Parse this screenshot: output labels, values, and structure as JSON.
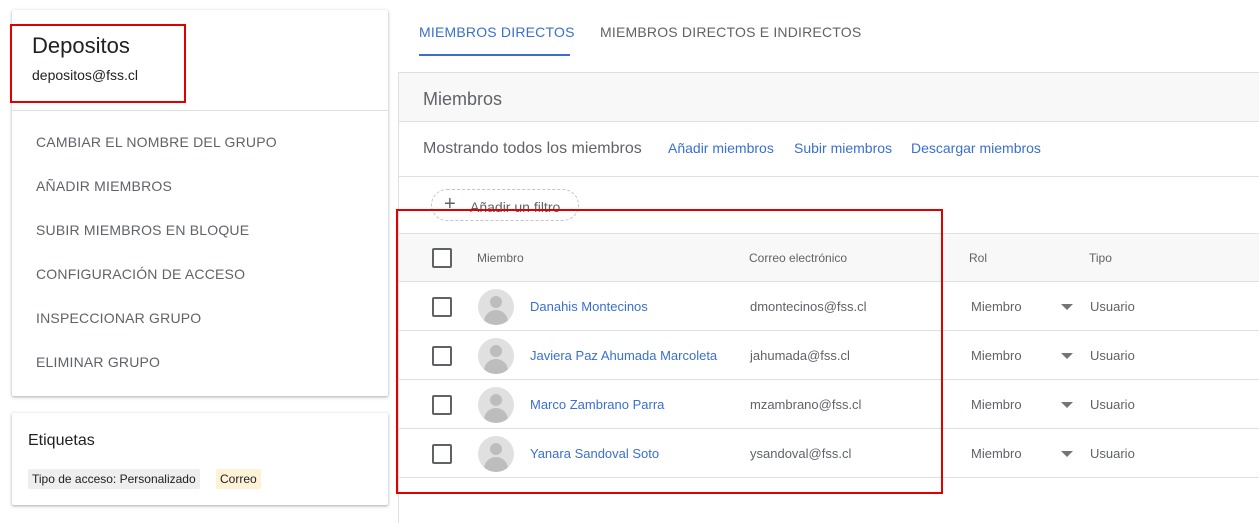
{
  "group": {
    "name": "Depositos",
    "email": "depositos@fss.cl",
    "actions": [
      {
        "label": "CAMBIAR EL NOMBRE DEL GRUPO"
      },
      {
        "label": "AÑADIR MIEMBROS"
      },
      {
        "label": "SUBIR MIEMBROS EN BLOQUE"
      },
      {
        "label": "CONFIGURACIÓN DE ACCESO"
      },
      {
        "label": "INSPECCIONAR GRUPO"
      },
      {
        "label": "ELIMINAR GRUPO"
      }
    ]
  },
  "tags": {
    "title": "Etiquetas",
    "chips": [
      "Tipo de acceso: Personalizado",
      "Correo"
    ]
  },
  "tabs": [
    {
      "label": "MIEMBROS DIRECTOS",
      "active": true
    },
    {
      "label": "MIEMBROS DIRECTOS E INDIRECTOS",
      "active": false
    }
  ],
  "members_panel": {
    "title": "Miembros",
    "showing": "Mostrando todos los miembros",
    "links": {
      "add": "Añadir miembros",
      "upload": "Subir miembros",
      "download": "Descargar miembros"
    },
    "filter_label": "Añadir un filtro",
    "columns": {
      "member": "Miembro",
      "email": "Correo electrónico",
      "role": "Rol",
      "type": "Tipo"
    },
    "rows": [
      {
        "name": "Danahis Montecinos",
        "email": "dmontecinos@fss.cl",
        "role": "Miembro",
        "type": "Usuario"
      },
      {
        "name": "Javiera Paz Ahumada Marcoleta",
        "email": "jahumada@fss.cl",
        "role": "Miembro",
        "type": "Usuario"
      },
      {
        "name": "Marco Zambrano Parra",
        "email": "mzambrano@fss.cl",
        "role": "Miembro",
        "type": "Usuario"
      },
      {
        "name": "Yanara Sandoval Soto",
        "email": "ysandoval@fss.cl",
        "role": "Miembro",
        "type": "Usuario"
      }
    ]
  },
  "colors": {
    "accent": "#3b6fcf",
    "highlight": "#e00000",
    "text_secondary": "#5f6368",
    "chip_mail": "#fdf1d6"
  }
}
